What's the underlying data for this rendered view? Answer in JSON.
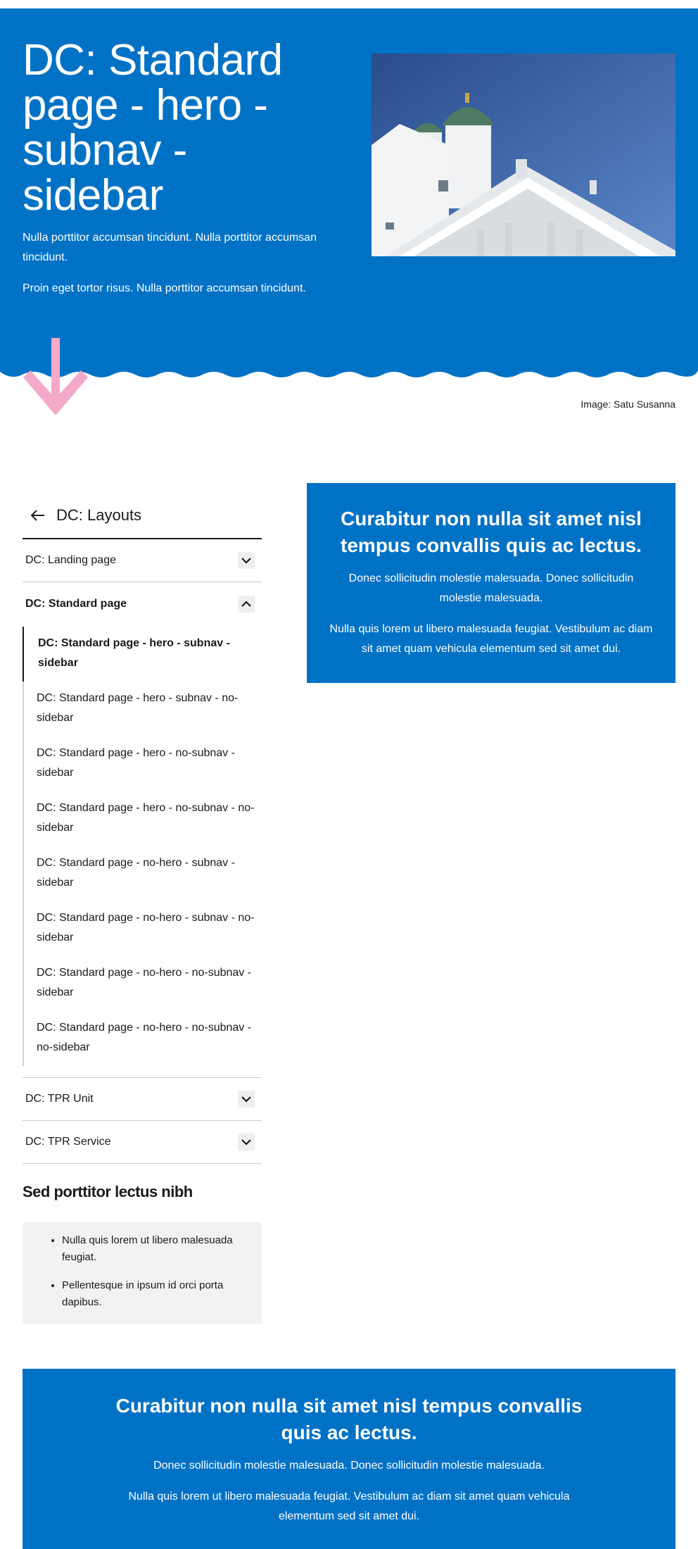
{
  "hero": {
    "title": "DC: Standard page - hero - subnav - sidebar",
    "paragraph_1": "Nulla porttitor accumsan tincidunt. Nulla porttitor accumsan tincidunt.",
    "paragraph_2": "Proin eget tortor risus. Nulla porttitor accumsan tincidunt.",
    "image_caption": "Image: Satu Susanna"
  },
  "subnav": {
    "back_label": "DC: Layouts",
    "items": [
      {
        "label": "DC: Landing page"
      },
      {
        "label": "DC: Standard page"
      },
      {
        "label": "DC: TPR Unit"
      },
      {
        "label": "DC: TPR Service"
      }
    ],
    "subitems": [
      {
        "label": "DC: Standard page - hero - subnav - sidebar"
      },
      {
        "label": "DC: Standard page - hero - subnav - no-sidebar"
      },
      {
        "label": "DC: Standard page - hero - no-subnav - sidebar"
      },
      {
        "label": "DC: Standard page - hero - no-subnav - no-sidebar"
      },
      {
        "label": "DC: Standard page - no-hero - subnav - sidebar"
      },
      {
        "label": "DC: Standard page - no-hero - subnav - no-sidebar"
      },
      {
        "label": "DC: Standard page - no-hero - no-subnav - sidebar"
      },
      {
        "label": "DC: Standard page - no-hero - no-subnav - no-sidebar"
      }
    ]
  },
  "sidebar": {
    "title": "Sed porttitor lectus nibh",
    "list": [
      "Nulla quis lorem ut libero malesuada feugiat.",
      "Pellentesque in ipsum id orci porta dapibus."
    ]
  },
  "promo_1": {
    "title": "Curabitur non nulla sit amet nisl tempus convallis quis ac lectus.",
    "paragraph_1": "Donec sollicitudin molestie malesuada. Donec sollicitudin molestie malesuada.",
    "paragraph_2": "Nulla quis lorem ut libero malesuada feugiat. Vestibulum ac diam sit amet quam vehicula elementum sed sit amet dui."
  },
  "promo_2": {
    "title": "Curabitur non nulla sit amet nisl tempus convallis quis ac lectus.",
    "paragraph_1": "Donec sollicitudin molestie malesuada. Donec sollicitudin molestie malesuada.",
    "paragraph_2": "Nulla quis lorem ut libero malesuada feugiat. Vestibulum ac diam sit amet quam vehicula elementum sed sit amet dui."
  },
  "colors": {
    "brand_blue": "#0072c6",
    "accent_pink": "#f4a9c8",
    "sidebar_bg": "#f2f2f2"
  },
  "icons": [
    "back-arrow-icon",
    "chevron-down-icon",
    "chevron-up-icon",
    "koros-wave",
    "arrow-down-icon"
  ]
}
